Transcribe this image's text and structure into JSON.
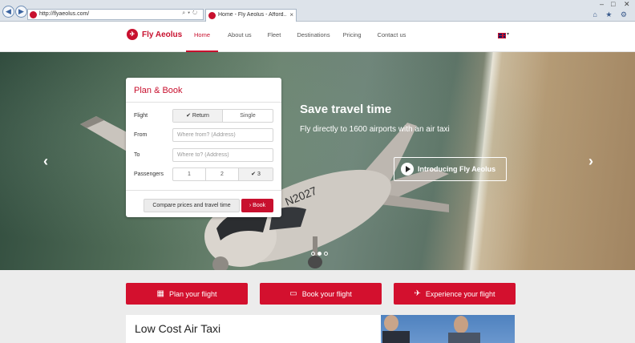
{
  "browser": {
    "url": "http://flyaeolus.com/",
    "tab_title": "Home - Fly Aeolus - Afford...",
    "tab_close": "×",
    "win_minimize": "–",
    "win_maximize": "□",
    "win_close": "✕",
    "toolbar_icons": "⌂ ★ ⚙"
  },
  "header": {
    "brand": "Fly Aeolus",
    "nav": [
      "Home",
      "About us",
      "Fleet",
      "Destinations",
      "Pricing",
      "Contact us"
    ],
    "active_nav": "Home"
  },
  "hero": {
    "title": "Save travel time",
    "subtitle": "Fly directly to 1600 airports with an air taxi",
    "video_button": "Introducing Fly Aeolus",
    "prev_arrow": "‹",
    "next_arrow": "›",
    "slide_count": 3,
    "active_slide": 2
  },
  "booking": {
    "title": "Plan & Book",
    "flight_label": "Flight",
    "flight_options": [
      "Return",
      "Single"
    ],
    "flight_selected": "Return",
    "from_label": "From",
    "from_placeholder": "Where from? (Address)",
    "to_label": "To",
    "to_placeholder": "Where to? (Address)",
    "passengers_label": "Passengers",
    "passenger_options": [
      "1",
      "2",
      "3"
    ],
    "passengers_selected": "3",
    "compare_button": "Compare prices and travel time",
    "book_button": "Book"
  },
  "features": [
    {
      "label": "Plan your flight",
      "icon": "calendar-icon"
    },
    {
      "label": "Book your flight",
      "icon": "laptop-icon"
    },
    {
      "label": "Experience your flight",
      "icon": "airplane-icon"
    }
  ],
  "content": {
    "title": "Low Cost Air Taxi"
  },
  "colors": {
    "brand_red": "#c8102e",
    "white": "#ffffff"
  }
}
